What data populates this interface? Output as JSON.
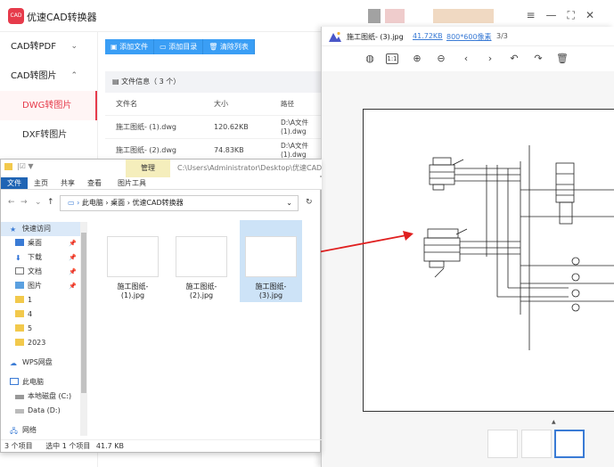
{
  "app": {
    "logo_text": "CAD",
    "title": "优速CAD转换器",
    "controls": {
      "menu": "≡",
      "minimize": "—",
      "maximize": "⛶",
      "close": "✕"
    }
  },
  "sidebar": {
    "groups": [
      {
        "label": "CAD转PDF",
        "chevron": "⌄"
      },
      {
        "label": "CAD转图片",
        "chevron": "⌃"
      }
    ],
    "subitems": [
      {
        "label": "DWG转图片"
      },
      {
        "label": "DXF转图片"
      }
    ]
  },
  "toolbar": {
    "add_file": "添加文件",
    "add_folder": "添加目录",
    "clear_list": "清除列表"
  },
  "file_table": {
    "info": "文件信息（ 3 个）",
    "headers": [
      "文件名",
      "大小",
      "路径"
    ],
    "rows": [
      {
        "name": "施工图纸- (1).dwg",
        "size": "120.62KB",
        "path": "D:\\A文件\n(1).dwg"
      },
      {
        "name": "施工图纸- (2).dwg",
        "size": "74.83KB",
        "path": "D:\\A文件\n(1).dwg"
      }
    ]
  },
  "viewer": {
    "file_name": "施工图纸- (3).jpg",
    "file_size": "41.72KB",
    "resolution": "800*600像素",
    "index": "3/3",
    "tools": [
      "fit-icon",
      "actual-size-icon",
      "zoom-in-icon",
      "zoom-out-icon",
      "prev-icon",
      "next-icon",
      "rotate-left-icon",
      "rotate-right-icon",
      "delete-icon"
    ],
    "actual_size_label": "1:1"
  },
  "explorer": {
    "manage_tab": "管理",
    "title_path": "C:\\Users\\Administrator\\Desktop\\优速CAD",
    "ribbon": [
      "文件",
      "主页",
      "共享",
      "查看",
      "图片工具"
    ],
    "breadcrumb": [
      "此电脑",
      "桌面",
      "优速CAD转换器"
    ],
    "nav": [
      {
        "label": "快速访问",
        "sel": true
      },
      {
        "label": "桌面",
        "pin": true
      },
      {
        "label": "下载",
        "pin": true
      },
      {
        "label": "文档",
        "pin": true
      },
      {
        "label": "图片",
        "pin": true
      },
      {
        "label": "1"
      },
      {
        "label": "4"
      },
      {
        "label": "5"
      },
      {
        "label": "2023"
      },
      {
        "label": "WPS网盘"
      },
      {
        "label": "此电脑"
      },
      {
        "label": "本地磁盘 (C:)"
      },
      {
        "label": "Data (D:)"
      },
      {
        "label": "网络"
      }
    ],
    "files": [
      {
        "name": "施工图纸-\n(1).jpg"
      },
      {
        "name": "施工图纸-\n(2).jpg"
      },
      {
        "name": "施工图纸-\n(3).jpg"
      }
    ],
    "status": {
      "count": "3 个项目",
      "selected": "选中 1 个项目",
      "size": "41.7 KB"
    }
  }
}
